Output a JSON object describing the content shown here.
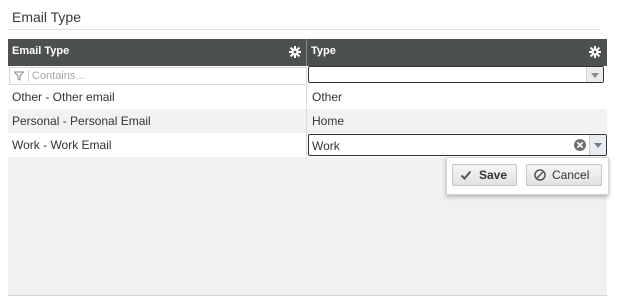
{
  "page": {
    "title": "Email Type"
  },
  "grid": {
    "columns": [
      {
        "label": "Email Type"
      },
      {
        "label": "Type"
      }
    ],
    "filter": {
      "placeholder": "Contains...",
      "type_value": ""
    },
    "rows": [
      {
        "email_type": "Other - Other email",
        "type": "Other"
      },
      {
        "email_type": "Personal - Personal Email",
        "type": "Home"
      },
      {
        "email_type": "Work - Work Email",
        "type": "Work"
      }
    ],
    "editor": {
      "value": "Work"
    }
  },
  "popup": {
    "save_label": "Save",
    "cancel_label": "Cancel"
  },
  "icons": {
    "gear": "gear-icon",
    "filter": "filter-icon",
    "dropdown": "chevron-down-icon",
    "clear": "clear-icon",
    "save": "check-icon",
    "cancel": "ban-icon"
  },
  "colors": {
    "header_bg": "#4d5050",
    "grid_bg": "#f1f1f1",
    "alt_row": "#f2f2f2"
  }
}
